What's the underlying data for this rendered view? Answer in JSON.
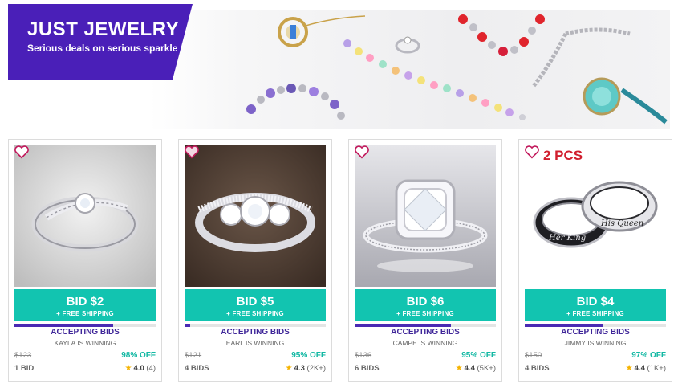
{
  "banner": {
    "title": "JUST JEWELRY",
    "subtitle": "Serious deals on serious sparkle",
    "brand_color": "#4a1fb8"
  },
  "accent": "#12c4b0",
  "products": [
    {
      "bid_label": "BID $2",
      "shipping": "+ FREE SHIPPING",
      "status": "ACCEPTING BIDS",
      "winner": "KAYLA IS WINNING",
      "original_price": "$123",
      "discount": "98% OFF",
      "bids": "1 BID",
      "rating": "4.0",
      "reviews": "(4)",
      "favorited": false,
      "progress": 0.7,
      "image": "silver-crossover-ring-photo"
    },
    {
      "bid_label": "BID $5",
      "shipping": "+ FREE SHIPPING",
      "status": "ACCEPTING BIDS",
      "winner": "EARL IS WINNING",
      "original_price": "$121",
      "discount": "95% OFF",
      "bids": "4 BIDS",
      "rating": "4.3",
      "reviews": "(2K+)",
      "favorited": true,
      "progress": 0.04,
      "image": "three-stone-ring-photo"
    },
    {
      "bid_label": "BID $6",
      "shipping": "+ FREE SHIPPING",
      "status": "ACCEPTING BIDS",
      "winner": "CAMPE IS WINNING",
      "original_price": "$136",
      "discount": "95% OFF",
      "bids": "6 BIDS",
      "rating": "4.4",
      "reviews": "(5K+)",
      "favorited": false,
      "progress": 0.68,
      "image": "cushion-halo-ring-photo"
    },
    {
      "bid_label": "BID $4",
      "shipping": "+ FREE SHIPPING",
      "status": "ACCEPTING BIDS",
      "winner": "JIMMY IS WINNING",
      "original_price": "$150",
      "discount": "97% OFF",
      "bids": "4 BIDS",
      "rating": "4.4",
      "reviews": "(1K+)",
      "favorited": false,
      "progress": 0.55,
      "image": "couple-rings-photo",
      "badge": "2 PCS",
      "engraving_left": "Her King",
      "engraving_right": "His Queen"
    }
  ]
}
